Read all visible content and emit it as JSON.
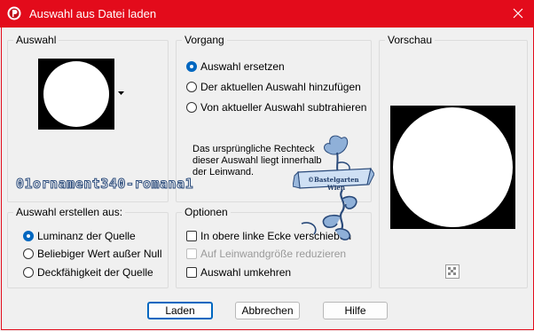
{
  "window": {
    "title": "Auswahl aus Datei laden"
  },
  "icons": {
    "app": "app-logo-icon",
    "close": "close-icon",
    "dropdown": "dropdown-arrow-icon",
    "transparency": "transparency-checker-icon"
  },
  "colors": {
    "titlebar": "#e30b1b",
    "accent": "#0067c0"
  },
  "auswahl": {
    "label": "Auswahl"
  },
  "vorgang": {
    "label": "Vorgang",
    "options": [
      "Auswahl ersetzen",
      "Der aktuellen Auswahl hinzufügen",
      "Von aktueller Auswahl subtrahieren"
    ],
    "selected": 0,
    "description": "Das ursprüngliche Rechteck dieser Auswahl liegt innerhalb der Leinwand."
  },
  "vorschau": {
    "label": "Vorschau"
  },
  "quelle": {
    "label": "Auswahl erstellen aus:",
    "options": [
      "Luminanz der Quelle",
      "Beliebiger Wert außer Null",
      "Deckfähigkeit der Quelle"
    ],
    "selected": 0
  },
  "optionen": {
    "label": "Optionen",
    "items": [
      {
        "label": "In obere linke Ecke verschieben",
        "checked": false,
        "enabled": true
      },
      {
        "label": "Auf Leinwandgröße reduzieren",
        "checked": false,
        "enabled": false
      },
      {
        "label": "Auswahl umkehren",
        "checked": false,
        "enabled": true
      }
    ]
  },
  "watermark": {
    "text": "01ornament340-romana1",
    "stamp_line1": "©Bastelgarten",
    "stamp_line2": "Wien"
  },
  "buttons": {
    "ok": "Laden",
    "cancel": "Abbrechen",
    "help": "Hilfe"
  }
}
